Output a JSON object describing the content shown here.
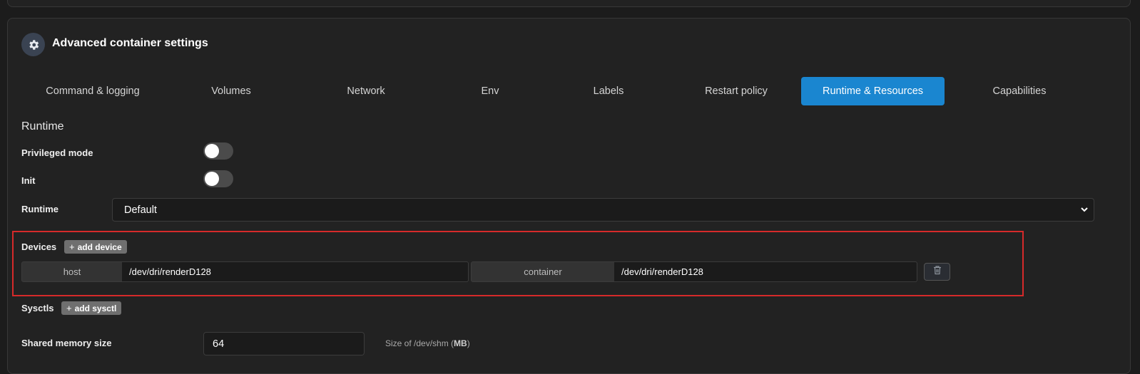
{
  "header": {
    "title": "Advanced container settings",
    "icon": "gear-icon"
  },
  "tabs": [
    {
      "label": "Command & logging",
      "active": false
    },
    {
      "label": "Volumes",
      "active": false
    },
    {
      "label": "Network",
      "active": false
    },
    {
      "label": "Env",
      "active": false
    },
    {
      "label": "Labels",
      "active": false
    },
    {
      "label": "Restart policy",
      "active": false
    },
    {
      "label": "Runtime & Resources",
      "active": true
    },
    {
      "label": "Capabilities",
      "active": false
    }
  ],
  "runtime": {
    "section_title": "Runtime",
    "privileged_label": "Privileged mode",
    "privileged_on": false,
    "init_label": "Init",
    "init_on": false,
    "runtime_label": "Runtime",
    "runtime_value": "Default"
  },
  "devices": {
    "label": "Devices",
    "add_label": "add device",
    "host_label": "host",
    "host_value": "/dev/dri/renderD128",
    "container_label": "container",
    "container_value": "/dev/dri/renderD128"
  },
  "sysctls": {
    "label": "Sysctls",
    "add_label": "add sysctl"
  },
  "shm": {
    "label": "Shared memory size",
    "value": "64",
    "hint_prefix": "Size of /dev/shm (",
    "hint_unit": "MB",
    "hint_suffix": ")"
  },
  "colors": {
    "accent": "#1a86d0",
    "highlight": "#d62a2a"
  }
}
